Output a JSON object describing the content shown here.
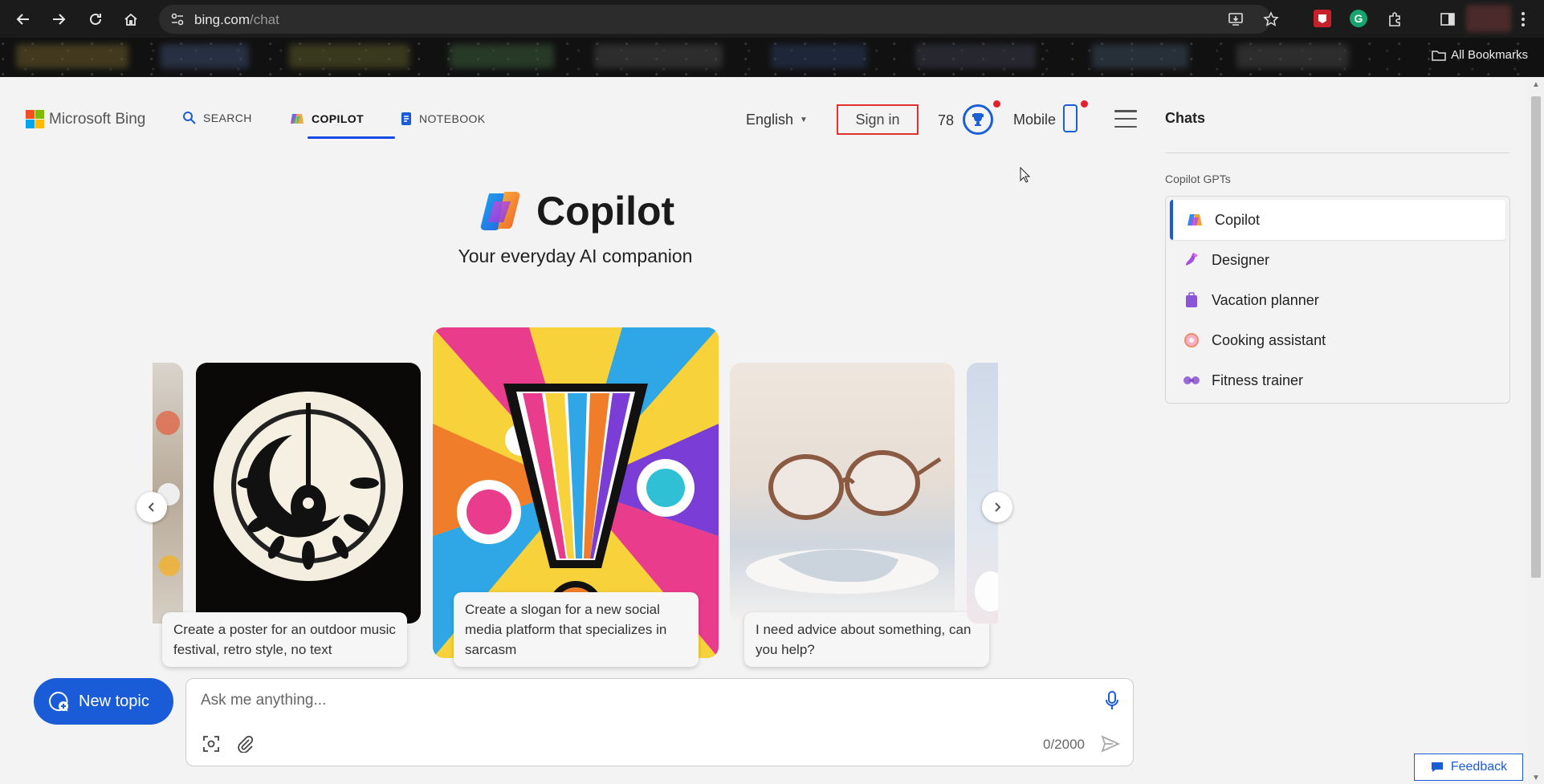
{
  "browser": {
    "url_host": "bing.com",
    "url_path": "/chat",
    "all_bookmarks_label": "All Bookmarks"
  },
  "header": {
    "logo_text": "Microsoft Bing",
    "tabs": [
      {
        "label": "SEARCH",
        "icon": "search-icon"
      },
      {
        "label": "COPILOT",
        "icon": "copilot-icon",
        "active": true
      },
      {
        "label": "NOTEBOOK",
        "icon": "notebook-icon"
      }
    ],
    "language": "English",
    "signin_label": "Sign in",
    "rewards_points": "78",
    "mobile_label": "Mobile"
  },
  "hero": {
    "title": "Copilot",
    "subtitle": "Your everyday AI companion"
  },
  "carousel": {
    "cards": [
      {
        "caption": "Create a poster for an outdoor music festival, retro style, no text"
      },
      {
        "caption": "Create a slogan for a new social media platform that specializes in sarcasm"
      },
      {
        "caption": "I need advice about something, can you help?"
      }
    ]
  },
  "composer": {
    "new_topic_label": "New topic",
    "placeholder": "Ask me anything...",
    "char_count": "0/2000"
  },
  "sidebar": {
    "title": "Chats",
    "gpts_label": "Copilot GPTs",
    "gpts": [
      {
        "label": "Copilot",
        "icon": "copilot-icon",
        "active": true
      },
      {
        "label": "Designer",
        "icon": "designer-icon"
      },
      {
        "label": "Vacation planner",
        "icon": "suitcase-icon"
      },
      {
        "label": "Cooking assistant",
        "icon": "donut-icon"
      },
      {
        "label": "Fitness trainer",
        "icon": "dumbbell-icon"
      }
    ],
    "feedback_label": "Feedback"
  },
  "colors": {
    "accent": "#1a5cd8",
    "signin_highlight": "#e0312f"
  }
}
